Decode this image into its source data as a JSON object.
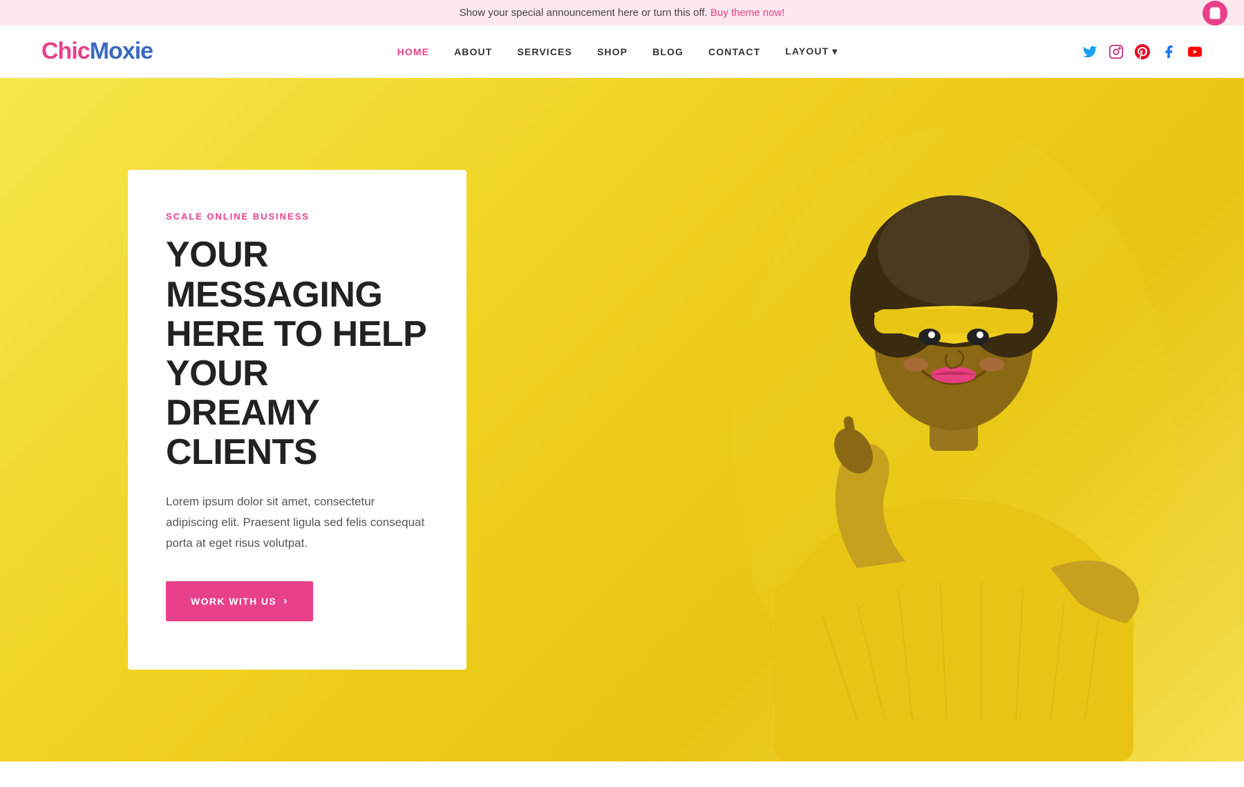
{
  "announcement": {
    "text": "Show your special announcement here or turn this off. ",
    "link_text": "Buy theme now!",
    "link_url": "#"
  },
  "header": {
    "logo": {
      "chic": "Chic",
      "moxie": "Moxie"
    },
    "nav_items": [
      {
        "label": "HOME",
        "active": true
      },
      {
        "label": "ABOUT",
        "active": false
      },
      {
        "label": "SERVICES",
        "active": false
      },
      {
        "label": "SHOP",
        "active": false
      },
      {
        "label": "BLOG",
        "active": false
      },
      {
        "label": "CONTACT",
        "active": false
      },
      {
        "label": "LAYOUT ▾",
        "active": false
      }
    ],
    "social": [
      {
        "name": "twitter",
        "symbol": "𝕏"
      },
      {
        "name": "instagram",
        "symbol": "◎"
      },
      {
        "name": "pinterest",
        "symbol": "℗"
      },
      {
        "name": "facebook",
        "symbol": "f"
      },
      {
        "name": "youtube",
        "symbol": "▶"
      }
    ]
  },
  "hero": {
    "scale_label": "SCALE ONLINE BUSINESS",
    "headline": "YOUR MESSAGING HERE TO HELP YOUR DREAMY CLIENTS",
    "body_text": "Lorem ipsum dolor sit amet, consectetur adipiscing elit. Praesent ligula sed felis consequat porta at eget risus volutpat.",
    "cta_label": "WORK WITH US",
    "cta_arrow": "›",
    "background_colors": {
      "from": "#f5e84a",
      "to": "#e8c515"
    }
  },
  "colors": {
    "pink": "#e8408a",
    "blue": "#3a6abf",
    "yellow": "#f5e84a",
    "dark": "#222222",
    "text": "#555555"
  }
}
